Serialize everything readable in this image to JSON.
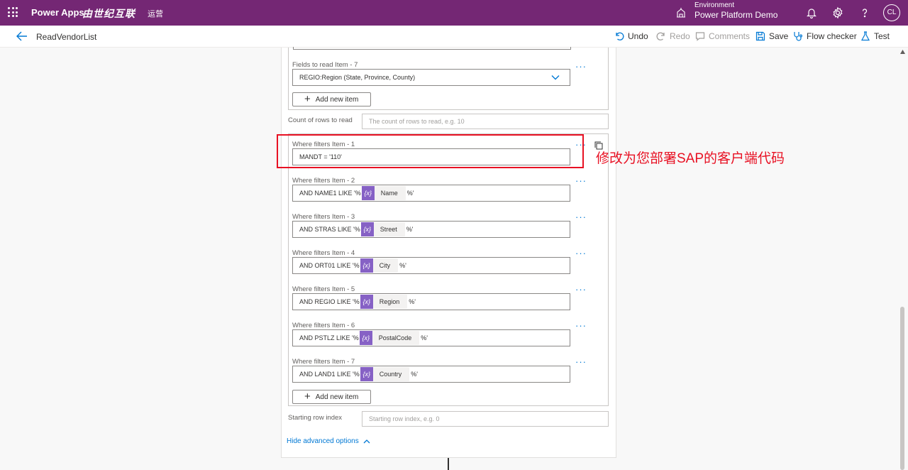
{
  "topbar": {
    "app_name": "Power Apps",
    "brand": "由世纪互联",
    "brand_suffix": "运营",
    "environment_label": "Environment",
    "environment_name": "Power Platform Demo",
    "avatar_initials": "CL",
    "bg_color": "#742774"
  },
  "cmdbar": {
    "flow_name": "ReadVendorList",
    "undo": "Undo",
    "redo": "Redo",
    "comments": "Comments",
    "save": "Save",
    "flow_checker": "Flow checker",
    "test": "Test"
  },
  "fields_to_read": {
    "item7_label": "Fields to read Item - 7",
    "item7_value": "REGIO:Region (State, Province, County)",
    "add_label": "Add new item"
  },
  "count_rows": {
    "label": "Count of rows to read",
    "placeholder": "The count of rows to read, e.g. 10"
  },
  "where_filters": {
    "items": [
      {
        "label": "Where filters Item - 1",
        "prefix": "MANDT = '110'",
        "token": "",
        "suffix": ""
      },
      {
        "label": "Where filters Item - 2",
        "prefix": "AND NAME1 LIKE '%",
        "token": "Name",
        "suffix": "%'"
      },
      {
        "label": "Where filters Item - 3",
        "prefix": "AND STRAS LIKE '%",
        "token": "Street",
        "suffix": "%'"
      },
      {
        "label": "Where filters Item - 4",
        "prefix": "AND ORT01 LIKE '%",
        "token": "City",
        "suffix": "%'"
      },
      {
        "label": "Where filters Item - 5",
        "prefix": "AND REGIO LIKE '%",
        "token": "Region",
        "suffix": "%'"
      },
      {
        "label": "Where filters Item - 6",
        "prefix": "AND PSTLZ LIKE '%",
        "token": "PostalCode",
        "suffix": "%'"
      },
      {
        "label": "Where filters Item - 7",
        "prefix": "AND LAND1 LIKE '%",
        "token": "Country",
        "suffix": "%'"
      }
    ],
    "add_label": "Add new item",
    "token_icon": "{x}"
  },
  "starting_row": {
    "label": "Starting row index",
    "placeholder": "Starting row index, e.g. 0"
  },
  "hide_advanced": "Hide advanced options",
  "annotation": {
    "text": "修改为您部署SAP的客户端代码",
    "color": "#e81123"
  },
  "colors": {
    "accent": "#0078d4",
    "token": "#8661c5"
  }
}
